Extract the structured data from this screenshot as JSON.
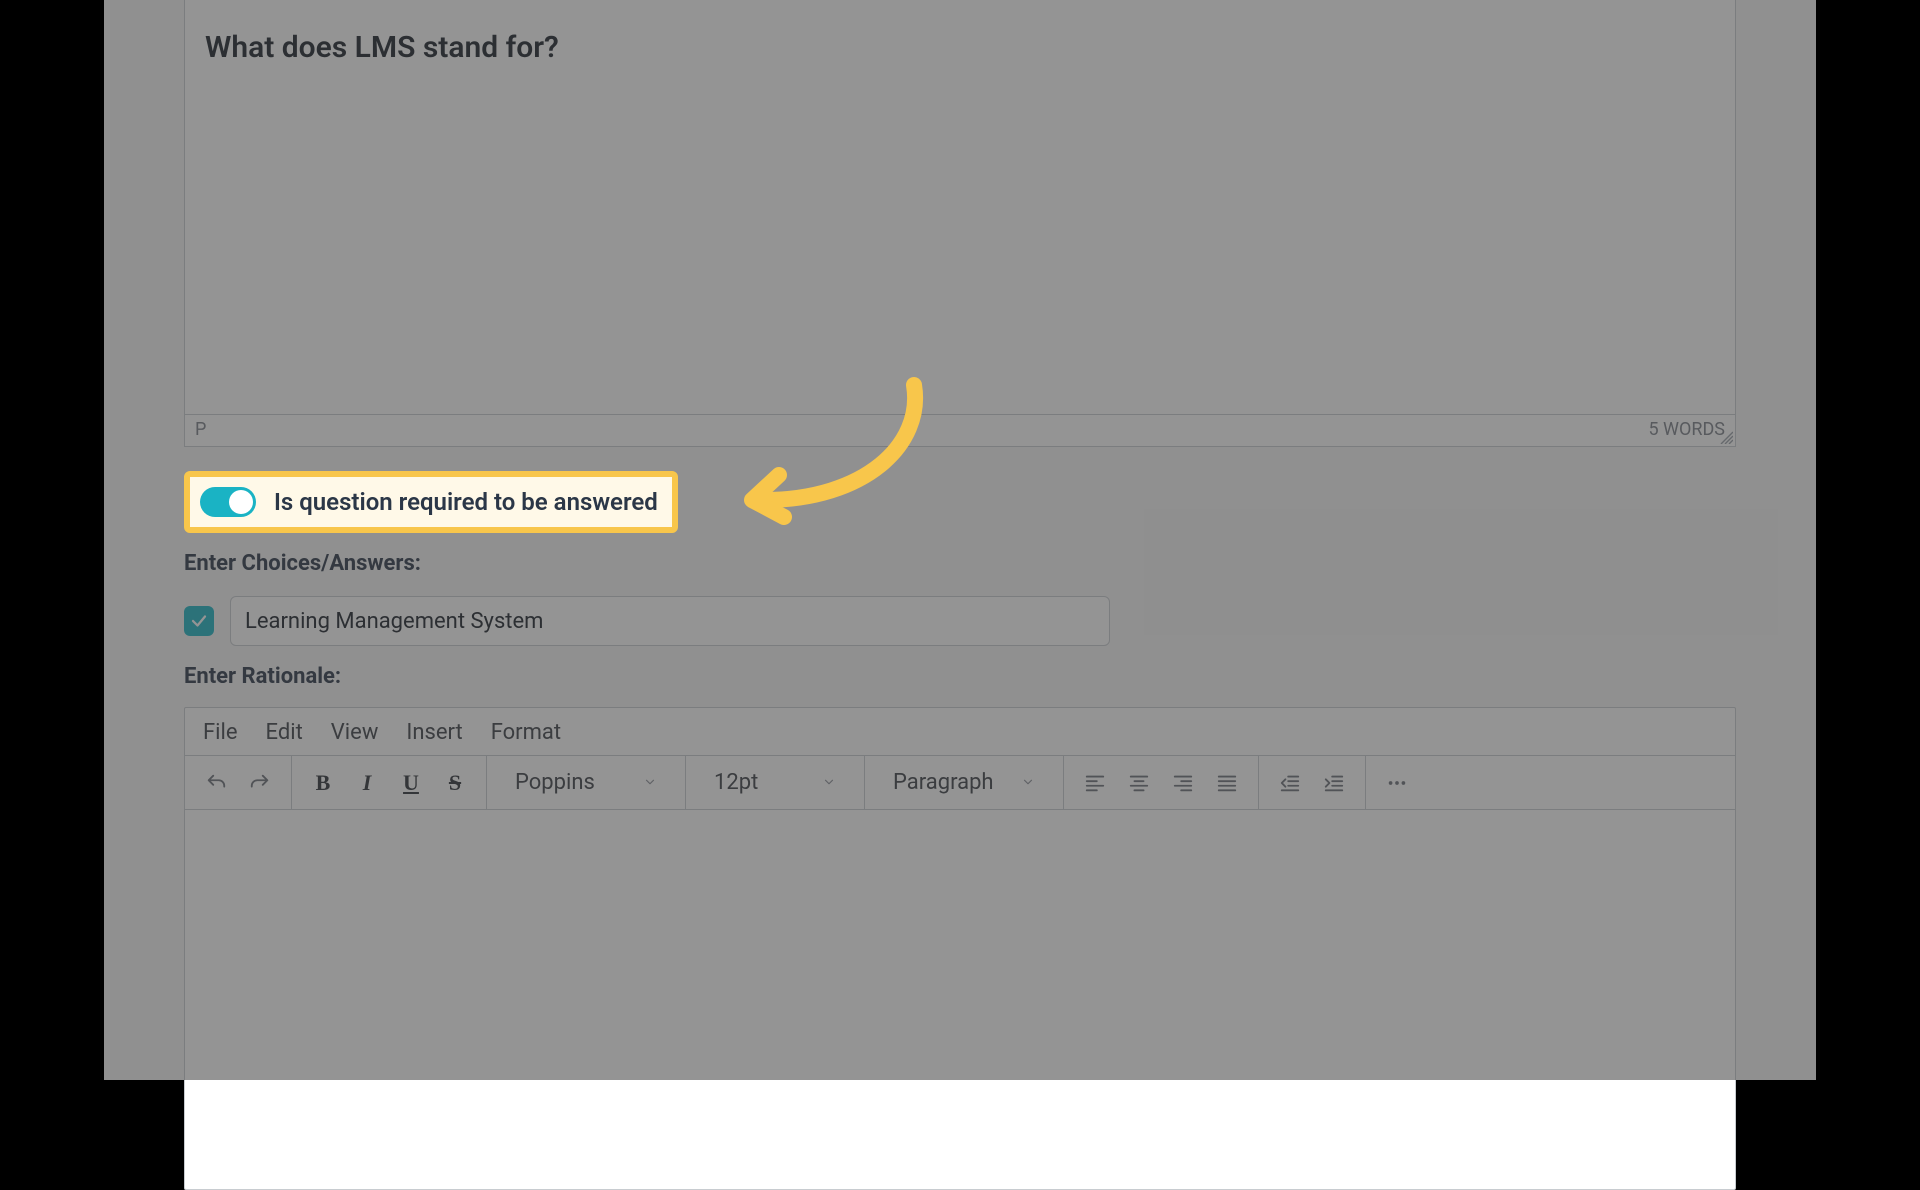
{
  "question_editor": {
    "text": "What does LMS stand for?",
    "path_indicator": "P",
    "word_count_label": "5 WORDS"
  },
  "required_toggle": {
    "label": "Is question required to be answered",
    "on": true
  },
  "choices": {
    "section_label": "Enter Choices/Answers:",
    "items": [
      {
        "checked": true,
        "text": "Learning Management System"
      }
    ]
  },
  "rationale": {
    "section_label": "Enter Rationale:",
    "menubar": [
      "File",
      "Edit",
      "View",
      "Insert",
      "Format"
    ],
    "font_family": "Poppins",
    "font_size": "12pt",
    "block_format": "Paragraph"
  },
  "colors": {
    "accent": "#1ab3c4",
    "highlight": "#f8c64b"
  }
}
